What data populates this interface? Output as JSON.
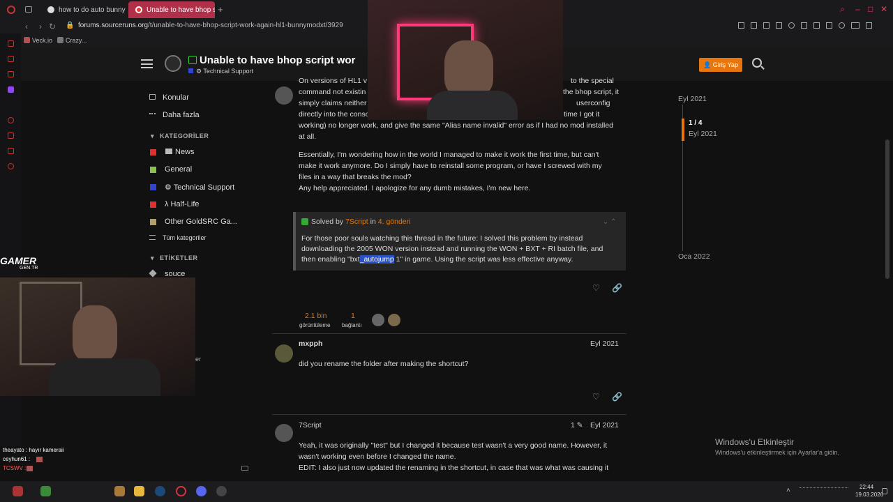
{
  "browser": {
    "tabs": [
      {
        "label": "how to do auto bunny hop"
      },
      {
        "label": "Unable to have bhop scrip"
      }
    ],
    "url_host": "forums.sourceruns.org",
    "url_path": "/t/unable-to-have-bhop-script-work-again-hl1-bunnymodxt/3929",
    "bookmarks": [
      "Veck.io",
      "Crazy..."
    ]
  },
  "header": {
    "title": "Unable to have bhop script wor",
    "category": "Technical Support",
    "login_label": "Giriş Yap"
  },
  "sidebar": {
    "items": [
      {
        "label": "Konular"
      },
      {
        "label": "Daha fazla"
      }
    ],
    "categories_title": "KATEGORİLER",
    "categories": [
      {
        "label": "News",
        "color": "#e03030"
      },
      {
        "label": "General",
        "color": "#8bc34a"
      },
      {
        "label": "⚙ Technical Support",
        "color": "#3344cc"
      },
      {
        "label": "λ Half-Life",
        "color": "#e03030"
      },
      {
        "label": "Other GoldSRC Ga...",
        "color": "#b0a070"
      }
    ],
    "all_categories": "Tüm kategoriler",
    "tags_title": "ETİKETLER",
    "tags": [
      "souce"
    ]
  },
  "post1": {
    "lines": [
      "On versions of HL1 v",
      "command not existin",
      "simply claims neither",
      "directly into the conso",
      "working) no longer work, and give the same \"Alias name invalid\" error as if I had no mod installed",
      "at all."
    ],
    "lines_right": [
      "to the special",
      "the bhop script, it",
      "userconfig",
      "time I got it"
    ],
    "para2": [
      "Essentially, I'm wondering how in the world I managed to make it work the first time, but can't",
      "make it work anymore. Do I simply have to reinstall some program, or have I screwed with my",
      "files in a way that breaks the mod?",
      "Any help appreciated. I apologize for any dumb mistakes, I'm new here."
    ],
    "solved_prefix": "Solved by",
    "solved_user": "7Script",
    "solved_in": "in",
    "solved_post": "4. gönderi",
    "solved_lines": [
      "For those poor souls watching this thread in the future: I solved this problem by instead",
      "downloading the 2005 WON version instead and running the WON + BXT + RI batch file, and"
    ],
    "solved_line3_a": "then enabling \"bxt",
    "solved_line3_hl": "_autojump",
    "solved_line3_b": " 1\" in game. Using the script was less effective anyway.",
    "views_num": "2.1 bin",
    "views_label": "görüntüleme",
    "links_num": "1",
    "links_label": "bağlantı"
  },
  "post2": {
    "user": "mxpph",
    "date": "Eyl 2021",
    "text": "did you rename the folder after making the shortcut?"
  },
  "post3": {
    "user": "7Script",
    "edit_count": "1",
    "date": "Eyl 2021",
    "lines": [
      "Yeah, it was originally \"test\" but I changed it because test wasn't a very good name. However, it",
      "wasn't working even before I changed the name.",
      "EDIT: I also just now updated the renaming in the shortcut, in case that was what was causing it"
    ]
  },
  "timeline": {
    "top_date": "Eyl 2021",
    "position": "1 / 4",
    "current_date": "Eyl 2021",
    "bottom_date": "Oca 2022"
  },
  "windows": {
    "activate_title": "Windows'u Etkinleştir",
    "activate_sub": "Windows'u etkinleştirmek için Ayarlar'a gidin.",
    "time": "22:44",
    "date": "19.03.2026"
  },
  "overlay": {
    "brand": "GAMER",
    "brand_sub": "GEN.TR",
    "chat": [
      "theayato : hayır kameraii",
      "ceyhun61 :",
      "TCSWV :"
    ],
    "side_letter": "er"
  }
}
